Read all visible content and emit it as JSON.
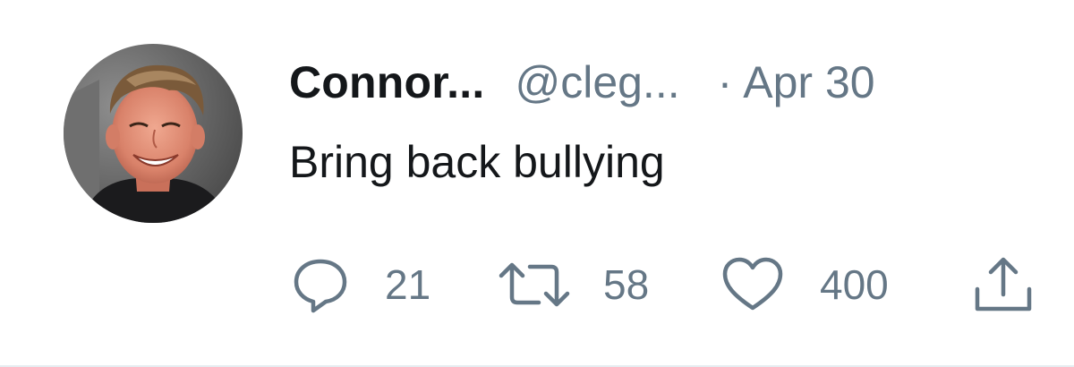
{
  "tweet": {
    "display_name": "Connor...",
    "handle": "@cleg...",
    "separator": "·",
    "date": "Apr 30",
    "text": "Bring back bullying",
    "actions": {
      "reply_count": "21",
      "retweet_count": "58",
      "like_count": "400"
    }
  },
  "colors": {
    "primary_text": "#14171a",
    "secondary_text": "#657786",
    "background": "#ffffff"
  },
  "icons": [
    "avatar-photo",
    "reply-icon",
    "retweet-icon",
    "like-icon",
    "share-icon"
  ]
}
